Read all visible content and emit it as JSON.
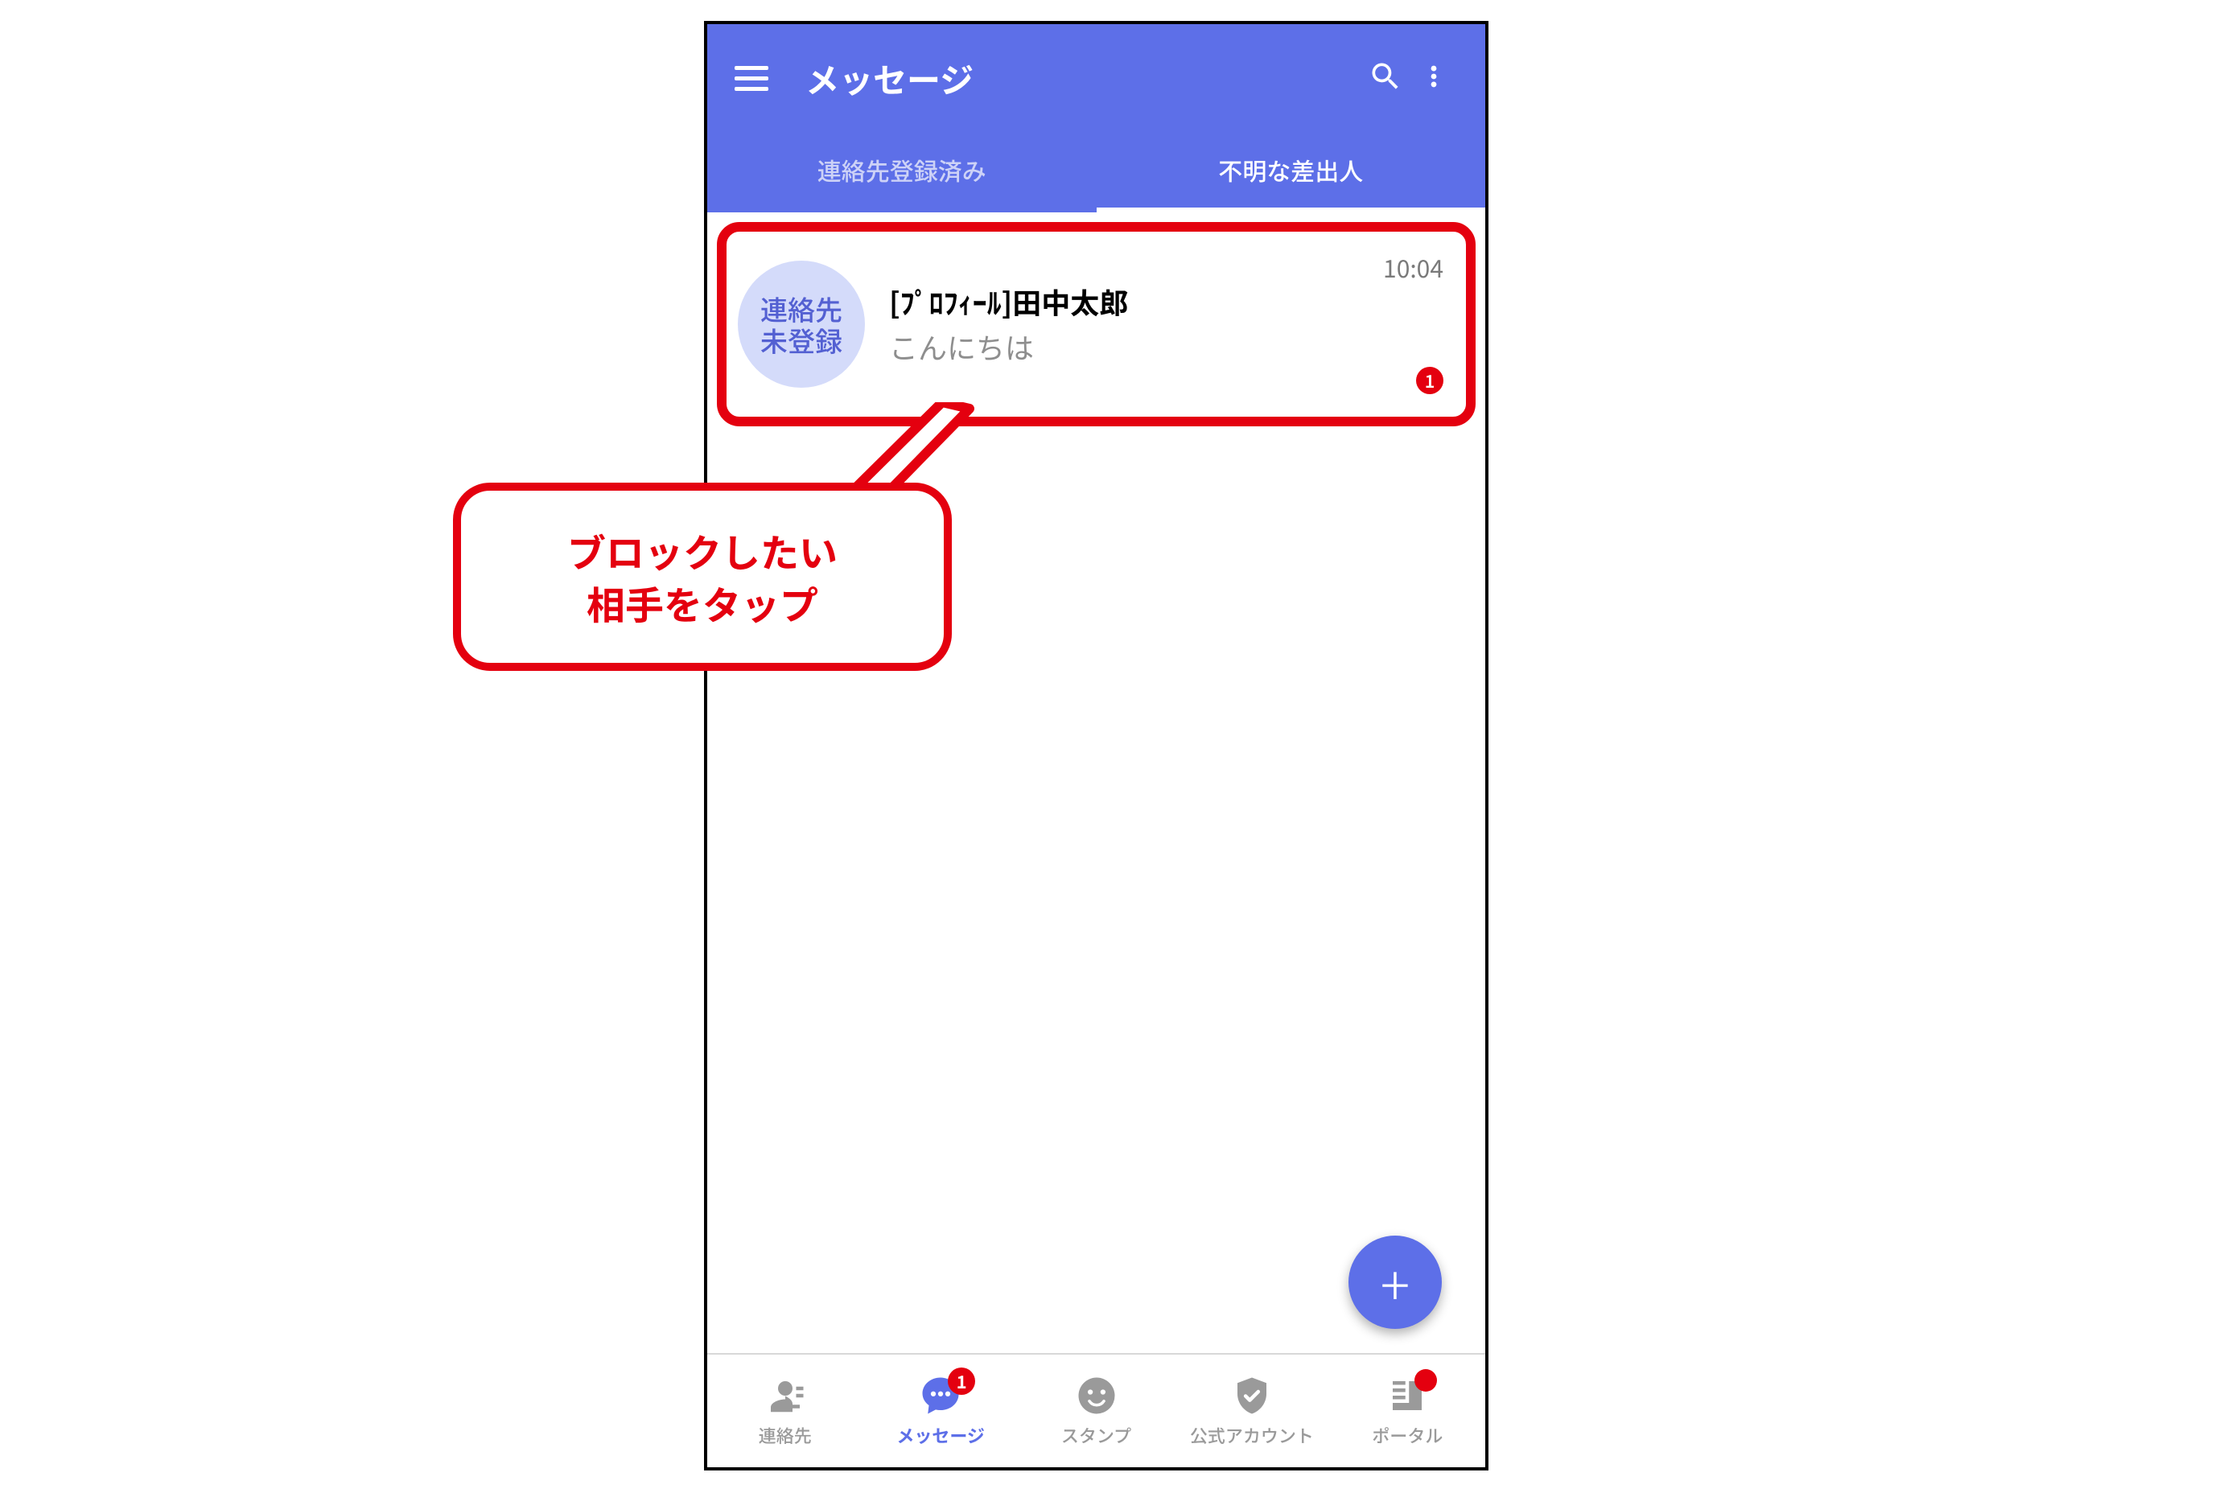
{
  "colors": {
    "accent": "#5d6fe8",
    "alert": "#e4000f",
    "muted": "#9a9a9a"
  },
  "header": {
    "title": "メッセージ"
  },
  "tabs": {
    "registered": "連絡先登録済み",
    "unknown": "不明な差出人"
  },
  "conversation": {
    "avatar_line1": "連絡先",
    "avatar_line2": "未登録",
    "name": "[ﾌﾟﾛﾌｨｰﾙ]田中太郎",
    "snippet": "こんにちは",
    "time": "10:04",
    "unread": "1"
  },
  "callout": {
    "line1": "ブロックしたい",
    "line2": "相手をタップ"
  },
  "fab": {
    "plus": "+"
  },
  "bottom_nav": {
    "items": [
      {
        "label": "連絡先"
      },
      {
        "label": "メッセージ",
        "badge": "1"
      },
      {
        "label": "スタンプ"
      },
      {
        "label": "公式アカウント"
      },
      {
        "label": "ポータル"
      }
    ]
  }
}
